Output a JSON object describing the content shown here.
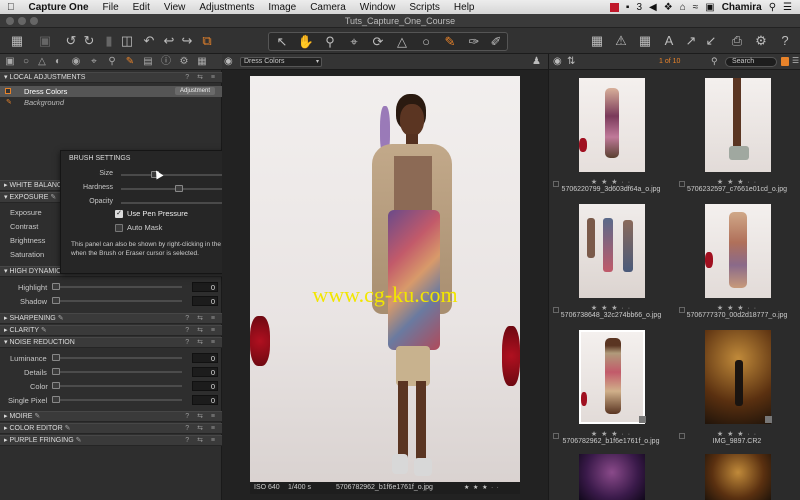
{
  "menubar": {
    "app": "Capture One",
    "items": [
      "File",
      "Edit",
      "View",
      "Adjustments",
      "Image",
      "Camera",
      "Window",
      "Scripts",
      "Help"
    ],
    "user": "Chamira",
    "badge_count": "3"
  },
  "window": {
    "title": "Tuts_Capture_One_Course"
  },
  "local_adjustments": {
    "title": "LOCAL ADJUSTMENTS",
    "layers": [
      {
        "name": "Dress Colors",
        "tag": "Adjustment"
      },
      {
        "name": "Background"
      }
    ]
  },
  "brush_settings": {
    "title": "BRUSH SETTINGS",
    "size_label": "Size",
    "size_value": "140",
    "hardness_label": "Hardness",
    "hardness_value": "55",
    "opacity_label": "Opacity",
    "opacity_value": "100",
    "pen_pressure": "Use Pen Pressure",
    "auto_mask": "Auto Mask",
    "note": "This panel can also be shown by right-clicking in the Viewer when the Brush or Eraser cursor is selected."
  },
  "sections": {
    "white_balance": "WHITE BALANC",
    "exposure": "EXPOSURE",
    "exposure_rows": [
      "Exposure",
      "Contrast",
      "Brightness",
      "Saturation"
    ],
    "hdr": "HIGH DYNAMIC",
    "hdr_rows": [
      {
        "label": "Highlight",
        "value": "0"
      },
      {
        "label": "Shadow",
        "value": "0"
      }
    ],
    "sharpening": "SHARPENING",
    "clarity": "CLARITY",
    "noise": "NOISE REDUCTION",
    "noise_rows": [
      {
        "label": "Luminance",
        "value": "0"
      },
      {
        "label": "Details",
        "value": "0"
      },
      {
        "label": "Color",
        "value": "0"
      },
      {
        "label": "Single Pixel",
        "value": "0"
      }
    ],
    "moire": "MOIRE",
    "color_editor": "COLOR EDITOR",
    "purple": "PURPLE FRINGING"
  },
  "viewer": {
    "layer_select": "Dress Colors",
    "watermark": "www.cg-ku.com",
    "iso": "ISO 640",
    "shutter": "1/400 s",
    "filename": "5706782962_b1f6e1761f_o.jpg"
  },
  "browser": {
    "counter": "1 of 10",
    "search_placeholder": "Search",
    "files": [
      "5706220799_3d603df64a_o.jpg",
      "5706232597_c7661e01cd_o.jpg",
      "5706738648_32c274bb66_o.jpg",
      "5706777370_00d2d18777_o.jpg",
      "5706782962_b1f6e1761f_o.jpg",
      "IMG_9897.CR2"
    ],
    "stars": "★ ★ ★ · ·"
  },
  "colors": {
    "accent": "#e8832a",
    "selection": "#ffffff",
    "watermark": "#f2e600"
  }
}
